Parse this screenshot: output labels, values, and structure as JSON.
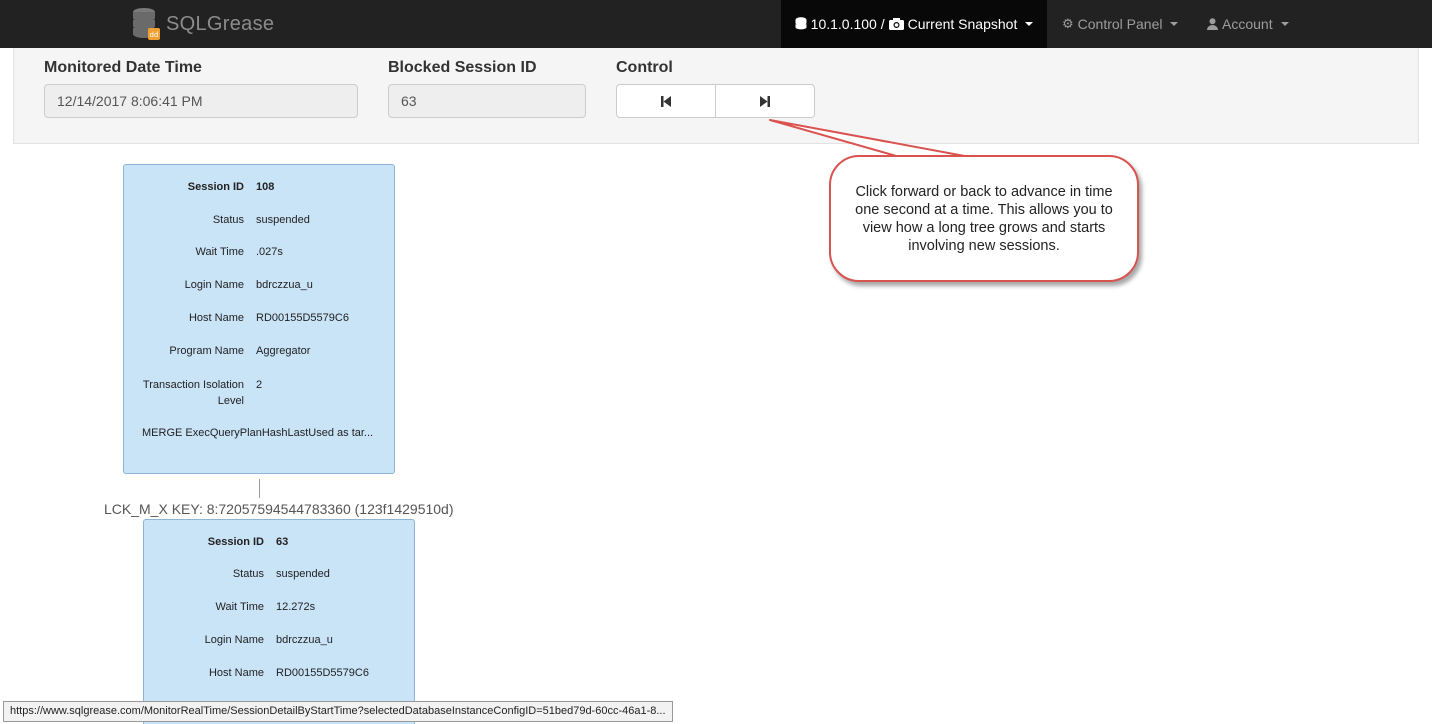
{
  "navbar": {
    "brand": "SQLGrease",
    "snapshot_label": "10.1.0.100 / Current Snapshot",
    "control_panel_label": "Control Panel",
    "account_label": "Account",
    "accent_color": "#f0a030"
  },
  "filters": {
    "monitored_label": "Monitored Date Time",
    "monitored_value": "12/14/2017 8:06:41 PM",
    "blocked_label": "Blocked Session ID",
    "blocked_value": "63",
    "control_label": "Control",
    "back_icon": "step-backward-icon",
    "forward_icon": "step-forward-icon"
  },
  "callout": {
    "text": "Click forward or back to advance in time one second at a time.  This allows you to view how a long tree grows and starts involving new sessions.",
    "border_color": "#d9534f"
  },
  "sessions": [
    {
      "fields": [
        {
          "label": "Session ID",
          "value": "108"
        },
        {
          "label": "Status",
          "value": "suspended"
        },
        {
          "label": "Wait Time",
          "value": ".027s"
        },
        {
          "label": "Login Name",
          "value": "bdrczzua_u"
        },
        {
          "label": "Host Name",
          "value": "RD00155D5579C6"
        },
        {
          "label": "Program Name",
          "value": "Aggregator"
        },
        {
          "label": "Transaction Isolation Level",
          "value": "2"
        }
      ],
      "sql": "MERGE ExecQueryPlanHashLastUsed as tar..."
    },
    {
      "wait_resource": "LCK_M_X KEY: 8:72057594544783360 (123f1429510d)",
      "fields": [
        {
          "label": "Session ID",
          "value": "63"
        },
        {
          "label": "Status",
          "value": "suspended"
        },
        {
          "label": "Wait Time",
          "value": "12.272s"
        },
        {
          "label": "Login Name",
          "value": "bdrczzua_u"
        },
        {
          "label": "Host Name",
          "value": "RD00155D5579C6"
        }
      ]
    }
  ],
  "status_bar": {
    "url": "https://www.sqlgrease.com/MonitorRealTime/SessionDetailByStartTime?selectedDatabaseInstanceConfigID=51bed79d-60cc-46a1-8..."
  }
}
